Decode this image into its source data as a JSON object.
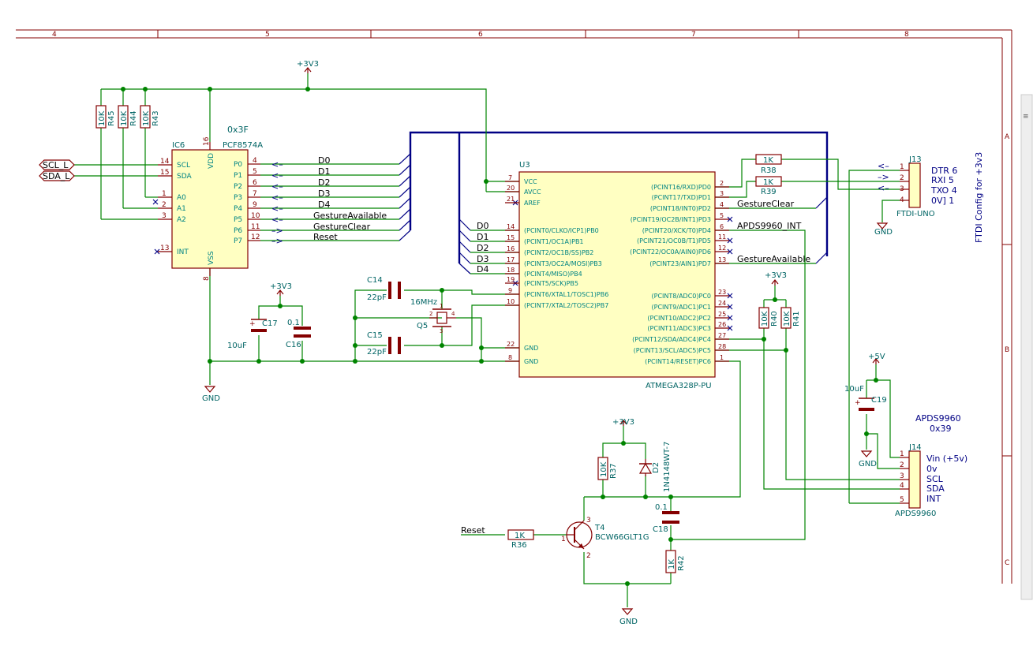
{
  "frame": {
    "columns": [
      "4",
      "5",
      "6",
      "7",
      "8"
    ],
    "rows": [
      "A",
      "B",
      "C"
    ]
  },
  "power": {
    "v33": "+3V3",
    "v5": "+5V",
    "gnd": "GND"
  },
  "ic6": {
    "ref": "IC6",
    "value": "PCF8574A",
    "address": "0x3F",
    "pins_left": [
      {
        "num": "14",
        "name": "SCL"
      },
      {
        "num": "15",
        "name": "SDA"
      },
      {
        "num": "1",
        "name": "A0"
      },
      {
        "num": "2",
        "name": "A1"
      },
      {
        "num": "3",
        "name": "A2"
      },
      {
        "num": "13",
        "name": "INT"
      }
    ],
    "pins_right": [
      {
        "num": "4",
        "name": "P0"
      },
      {
        "num": "5",
        "name": "P1"
      },
      {
        "num": "6",
        "name": "P2"
      },
      {
        "num": "7",
        "name": "P3"
      },
      {
        "num": "9",
        "name": "P4"
      },
      {
        "num": "10",
        "name": "P5"
      },
      {
        "num": "11",
        "name": "P6"
      },
      {
        "num": "12",
        "name": "P7"
      }
    ],
    "pin_top": {
      "num": "16",
      "name": "VDD"
    },
    "pin_bottom": {
      "num": "8",
      "name": "VSS"
    },
    "arrows": [
      "<–",
      "<–",
      "<–",
      "<–",
      "<–",
      "<–",
      "–>",
      "–>"
    ],
    "nets": [
      "D0",
      "D1",
      "D2",
      "D3",
      "D4",
      "GestureAvailable",
      "GestureClear",
      "Reset"
    ]
  },
  "hier_labels": [
    "SCL_L",
    "SDA_L"
  ],
  "resistors": {
    "r45": {
      "ref": "R45",
      "value": "10K"
    },
    "r44": {
      "ref": "R44",
      "value": "10K"
    },
    "r43": {
      "ref": "R43",
      "value": "10K"
    },
    "r38": {
      "ref": "R38",
      "value": "1K"
    },
    "r39": {
      "ref": "R39",
      "value": "1K"
    },
    "r40": {
      "ref": "R40",
      "value": "10K"
    },
    "r41": {
      "ref": "R41",
      "value": "10K"
    },
    "r36": {
      "ref": "R36",
      "value": "1K"
    },
    "r37": {
      "ref": "R37",
      "value": "10K"
    },
    "r42": {
      "ref": "R42",
      "value": "1K"
    }
  },
  "caps": {
    "c14": {
      "ref": "C14",
      "value": "22pF"
    },
    "c15": {
      "ref": "C15",
      "value": "22pF"
    },
    "c16": {
      "ref": "C16",
      "value": "0.1"
    },
    "c17": {
      "ref": "C17",
      "value": "10uF"
    },
    "c18": {
      "ref": "C18",
      "value": "0.1"
    },
    "c19": {
      "ref": "C19",
      "value": "10uF"
    }
  },
  "crystal": {
    "ref": "Q5",
    "value": "16MHz",
    "pins": [
      "2",
      "1",
      "3",
      "4"
    ]
  },
  "u3": {
    "ref": "U3",
    "value": "ATMEGA328P-PU",
    "pins_left": [
      {
        "num": "7",
        "name": "VCC"
      },
      {
        "num": "20",
        "name": "AVCC"
      },
      {
        "num": "21",
        "name": "AREF"
      },
      {
        "num": "14",
        "name": "(PCINT0/CLKO/ICP1)PB0"
      },
      {
        "num": "15",
        "name": "(PCINT1/OC1A)PB1"
      },
      {
        "num": "16",
        "name": "(PCINT2/OC1B/SS)PB2"
      },
      {
        "num": "17",
        "name": "(PCINT3/OC2A/MOSI)PB3"
      },
      {
        "num": "18",
        "name": "(PCINT4/MISO)PB4"
      },
      {
        "num": "19",
        "name": "(PCINT5/SCK)PB5"
      },
      {
        "num": "9",
        "name": "(PCINT6/XTAL1/TOSC1)PB6"
      },
      {
        "num": "10",
        "name": "(PCINT7/XTAL2/TOSC2)PB7"
      },
      {
        "num": "22",
        "name": "GND"
      },
      {
        "num": "8",
        "name": "GND"
      }
    ],
    "pins_right": [
      {
        "num": "2",
        "name": "(PCINT16/RXD)PD0"
      },
      {
        "num": "3",
        "name": "(PCINT17/TXD)PD1"
      },
      {
        "num": "4",
        "name": "(PCINT18/INT0)PD2"
      },
      {
        "num": "5",
        "name": "(PCINT19/OC2B/INT1)PD3"
      },
      {
        "num": "6",
        "name": "(PCINT20/XCK/T0)PD4"
      },
      {
        "num": "11",
        "name": "(PCINT21/OC0B/T1)PD5"
      },
      {
        "num": "12",
        "name": "(PCINT22/OC0A/AIN0)PD6"
      },
      {
        "num": "13",
        "name": "(PCINT23/AIN1)PD7"
      },
      {
        "num": "23",
        "name": "(PCINT8/ADC0)PC0"
      },
      {
        "num": "24",
        "name": "(PCINT9/ADC1)PC1"
      },
      {
        "num": "25",
        "name": "(PCINT10/ADC2)PC2"
      },
      {
        "num": "26",
        "name": "(PCINT11/ADC3)PC3"
      },
      {
        "num": "27",
        "name": "(PCINT12/SDA/ADC4)PC4"
      },
      {
        "num": "28",
        "name": "(PCINT13/SCL/ADC5)PC5"
      },
      {
        "num": "1",
        "name": "(PCINT14/RESET)PC6"
      }
    ],
    "left_nets": [
      "D0",
      "D1",
      "D2",
      "D3",
      "D4"
    ],
    "right_nets": [
      "GestureClear",
      "APDS9960_INT",
      "GestureAvailable"
    ]
  },
  "j13": {
    "ref": "J13",
    "value": "FTDI-UNO",
    "pins": [
      "1",
      "2",
      "3",
      "4"
    ],
    "arrows": [
      "<–",
      "–>",
      "<–",
      ""
    ],
    "labels": [
      "DTR 6",
      "RXI  5",
      "TXO 4",
      "0V] 1"
    ],
    "note": "FTDI Config for +3v3"
  },
  "j14": {
    "ref": "J14",
    "value": "APDS9960",
    "title": "APDS9960",
    "address": "0x39",
    "pins": [
      "1",
      "2",
      "3",
      "4",
      "5"
    ],
    "labels": [
      "Vin (+5v)",
      "0v",
      "SCL",
      "SDA",
      "INT"
    ]
  },
  "t4": {
    "ref": "T4",
    "value": "BCW66GLT1G",
    "pins": [
      "1",
      "2",
      "3"
    ]
  },
  "d2": {
    "ref": "D2",
    "value": "1N4148WT-7"
  },
  "reset_label": "Reset"
}
